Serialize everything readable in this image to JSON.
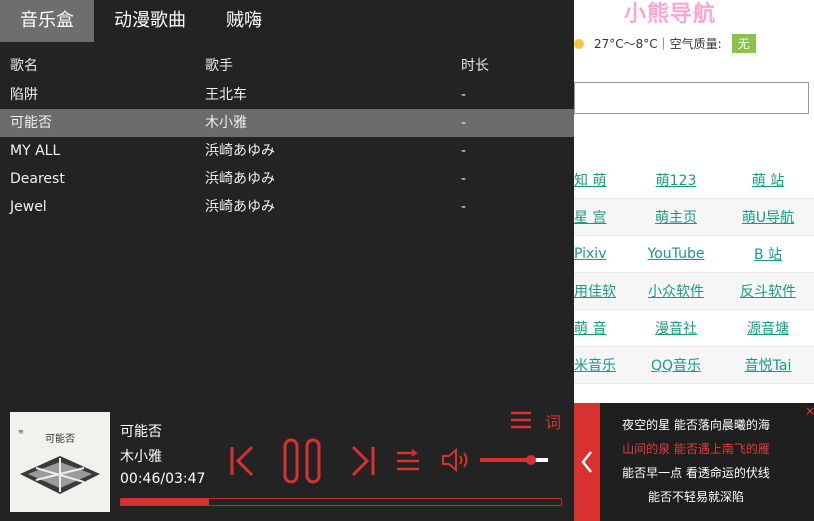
{
  "background_page": {
    "logo": "小熊导航",
    "weather": "27°C～8°C｜空气质量:",
    "air_quality": "无",
    "links": [
      [
        "知 萌",
        "萌123",
        "萌 站"
      ],
      [
        "星 宫",
        "萌主页",
        "萌U导航"
      ],
      [
        "Pixiv",
        "YouTube",
        "B 站"
      ],
      [
        "用佳软",
        "小众软件",
        "反斗软件"
      ],
      [
        "萌 音",
        "漫音社",
        "源音塘"
      ],
      [
        "米音乐",
        "QQ音乐",
        "音悦Tai"
      ]
    ]
  },
  "player": {
    "tabs": [
      {
        "label": "音乐盒",
        "active": true
      },
      {
        "label": "动漫歌曲",
        "active": false
      },
      {
        "label": "贼嗨",
        "active": false
      }
    ],
    "columns": {
      "song": "歌名",
      "artist": "歌手",
      "duration": "时长"
    },
    "songs": [
      {
        "title": "陷阱",
        "artist": "王北车",
        "duration": "-"
      },
      {
        "title": "可能否",
        "artist": "木小雅",
        "duration": "-",
        "selected": true
      },
      {
        "title": "MY ALL",
        "artist": "浜崎あゆみ",
        "duration": "-"
      },
      {
        "title": "Dearest",
        "artist": "浜崎あゆみ",
        "duration": "-"
      },
      {
        "title": "Jewel",
        "artist": "浜崎あゆみ",
        "duration": "-"
      }
    ],
    "now_playing": {
      "title": "可能否",
      "artist": "木小雅",
      "time": "00:46/03:47",
      "progress_fraction": 0.2
    },
    "album_art_text": "可能否",
    "lyric_button": "词",
    "volume_fraction": 0.75,
    "icons": [
      "menu-icon",
      "prev-icon",
      "pause-icon",
      "next-icon",
      "shuffle-icon",
      "volume-icon"
    ]
  },
  "lyrics": {
    "lines": [
      {
        "text": "夜空的星 能否落向晨曦的海",
        "current": false
      },
      {
        "text": "山间的泉 能否遇上南飞的雁",
        "current": true
      },
      {
        "text": "能否早一点 看透命运的伏线",
        "current": false
      },
      {
        "text": "能否不轻易就深陷",
        "current": false
      }
    ],
    "close": "×"
  },
  "colors": {
    "accent": "#d8312f",
    "panel": "#232323",
    "link": "#1a9a84"
  }
}
